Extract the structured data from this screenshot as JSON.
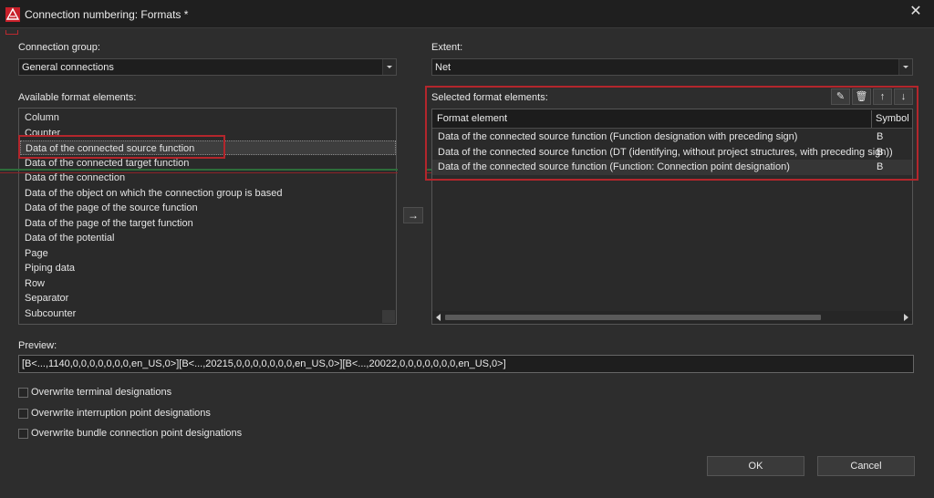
{
  "window": {
    "title": "Connection numbering: Formats *",
    "close_glyph": "✕"
  },
  "connection_group": {
    "label": "Connection group:",
    "value": "General connections"
  },
  "extent": {
    "label": "Extent:",
    "value": "Net"
  },
  "available": {
    "label": "Available format elements:",
    "items": [
      "Column",
      "Counter",
      "Data of the connected source function",
      "Data of the connected target function",
      "Data of the connection",
      "Data of the object on which the connection group is based",
      "Data of the page of the source function",
      "Data of the page of the target function",
      "Data of the potential",
      "Page",
      "Piping data",
      "Row",
      "Separator",
      "Subcounter"
    ],
    "selected_index": 2
  },
  "move_button_glyph": "→",
  "selected": {
    "label": "Selected format elements:",
    "columns": [
      "Format element",
      "Symbol"
    ],
    "rows": [
      [
        "Data of the connected source function (Function designation with preceding sign)",
        "B"
      ],
      [
        "Data of the connected source function (DT (identifying, without project structures, with preceding sign))",
        "B"
      ],
      [
        "Data of the connected source function (Function: Connection point designation)",
        "B"
      ]
    ],
    "toolbar": {
      "edit_glyph": "✎",
      "delete_glyph": "🗑",
      "up_glyph": "↑",
      "down_glyph": "↓"
    }
  },
  "preview": {
    "label": "Preview:",
    "value": "[B<...,1140,0,0,0,0,0,0,0,en_US,0>][B<...,20215,0,0,0,0,0,0,0,en_US,0>][B<...,20022,0,0,0,0,0,0,0,en_US,0>]"
  },
  "options": [
    "Overwrite terminal designations",
    "Overwrite interruption point designations",
    "Overwrite bundle connection point designations"
  ],
  "buttons": {
    "ok": "OK",
    "cancel": "Cancel"
  },
  "colors": {
    "accent_red": "#b3262c",
    "background": "#2d2d2d"
  }
}
